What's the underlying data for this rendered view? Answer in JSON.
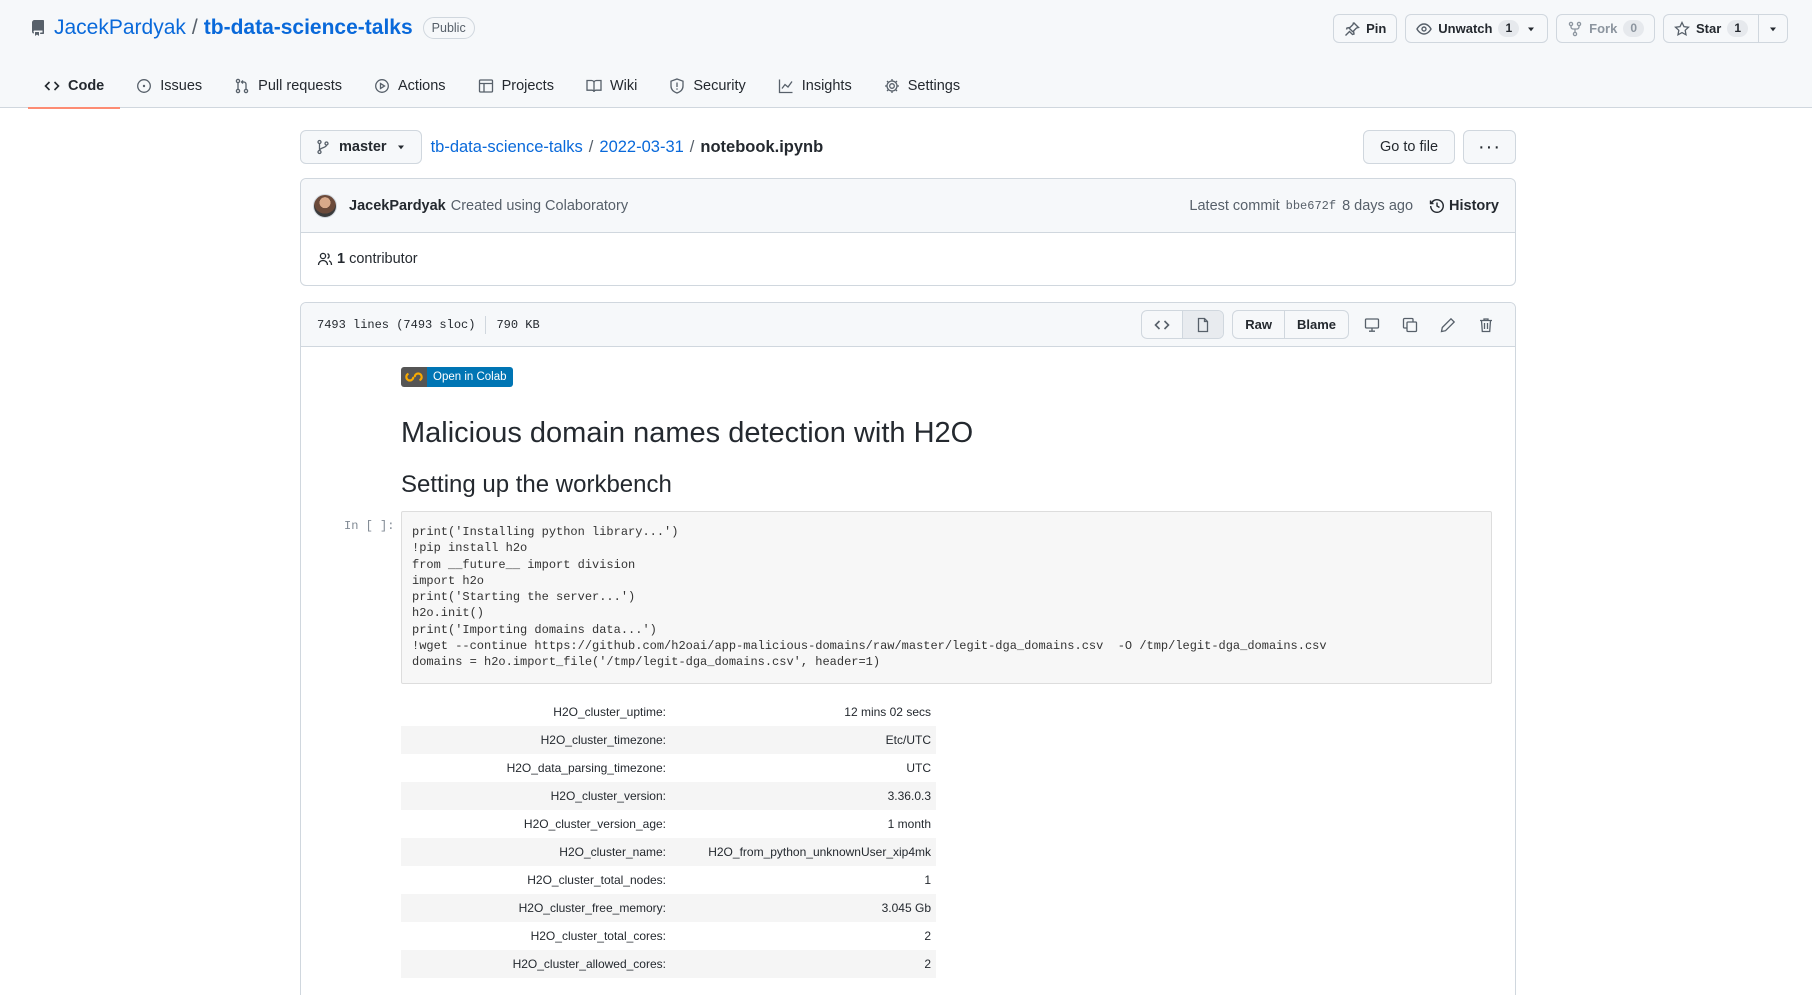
{
  "repo": {
    "owner": "JacekPardyak",
    "separator": "/",
    "name": "tb-data-science-talks",
    "visibility": "Public"
  },
  "header_actions": {
    "pin": "Pin",
    "unwatch": "Unwatch",
    "unwatch_count": "1",
    "fork": "Fork",
    "fork_count": "0",
    "star": "Star",
    "star_count": "1"
  },
  "tabs": [
    {
      "label": "Code",
      "icon": "code-icon",
      "active": true
    },
    {
      "label": "Issues",
      "icon": "issue-icon"
    },
    {
      "label": "Pull requests",
      "icon": "pull-request-icon"
    },
    {
      "label": "Actions",
      "icon": "play-icon"
    },
    {
      "label": "Projects",
      "icon": "table-icon"
    },
    {
      "label": "Wiki",
      "icon": "book-icon"
    },
    {
      "label": "Security",
      "icon": "shield-icon"
    },
    {
      "label": "Insights",
      "icon": "graph-icon"
    },
    {
      "label": "Settings",
      "icon": "gear-icon"
    }
  ],
  "branch": "master",
  "breadcrumb": {
    "root": "tb-data-science-talks",
    "folder": "2022-03-31",
    "file": "notebook.ipynb",
    "sep": "/"
  },
  "file_actions": {
    "go_to_file": "Go to file",
    "more": "···"
  },
  "commit": {
    "author": "JacekPardyak",
    "message": "Created using Colaboratory",
    "latest_label": "Latest commit",
    "sha": "bbe672f",
    "age": "8 days ago",
    "history": "History"
  },
  "contributors": {
    "count": "1",
    "label": "contributor"
  },
  "file_info": {
    "lines": "7493 lines (7493 sloc)",
    "size": "790 KB",
    "raw": "Raw",
    "blame": "Blame"
  },
  "notebook": {
    "colab_badge": "Open in Colab",
    "h1": "Malicious domain names detection with H2O",
    "h2": "Setting up the workbench",
    "prompt": "In [ ]:",
    "code_lines": [
      "print('Installing python library...')",
      "!pip install h2o",
      "from __future__ import division",
      "import h2o",
      "print('Starting the server...')",
      "h2o.init()",
      "print('Importing domains data...')",
      "!wget --continue https://github.com/h2oai/app-malicious-domains/raw/master/legit-dga_domains.csv  -O /tmp/legit-dga_domains.csv",
      "domains = h2o.import_file('/tmp/legit-dga_domains.csv', header=1)"
    ],
    "output_table": [
      {
        "key": "H2O_cluster_uptime:",
        "value": "12 mins 02 secs"
      },
      {
        "key": "H2O_cluster_timezone:",
        "value": "Etc/UTC"
      },
      {
        "key": "H2O_data_parsing_timezone:",
        "value": "UTC"
      },
      {
        "key": "H2O_cluster_version:",
        "value": "3.36.0.3"
      },
      {
        "key": "H2O_cluster_version_age:",
        "value": "1 month"
      },
      {
        "key": "H2O_cluster_name:",
        "value": "H2O_from_python_unknownUser_xip4mk"
      },
      {
        "key": "H2O_cluster_total_nodes:",
        "value": "1"
      },
      {
        "key": "H2O_cluster_free_memory:",
        "value": "3.045 Gb"
      },
      {
        "key": "H2O_cluster_total_cores:",
        "value": "2"
      },
      {
        "key": "H2O_cluster_allowed_cores:",
        "value": "2"
      }
    ]
  }
}
